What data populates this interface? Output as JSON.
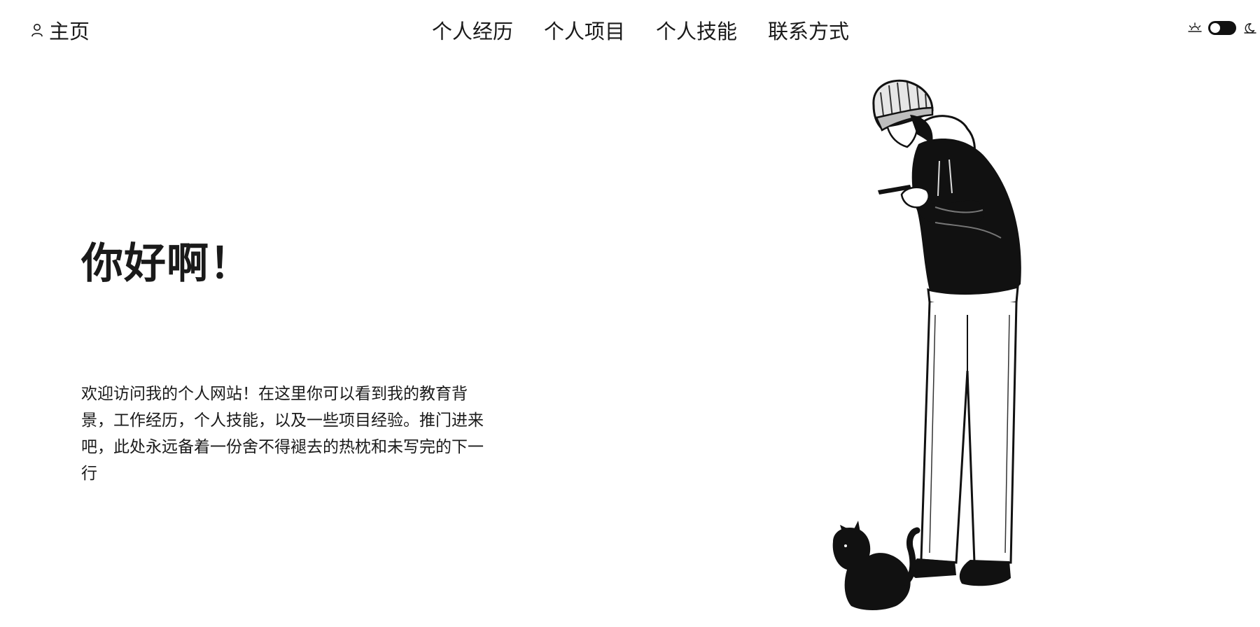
{
  "header": {
    "home": {
      "icon": "user-icon",
      "label": "主页"
    },
    "nav": [
      {
        "label": "个人经历"
      },
      {
        "label": "个人项目"
      },
      {
        "label": "个人技能"
      },
      {
        "label": "联系方式"
      }
    ],
    "theme": {
      "left_icon": "sunrise-icon",
      "right_icon": "moon-icon",
      "toggle_state": "dark"
    }
  },
  "hero": {
    "title": "你好啊！",
    "description": "欢迎访问我的个人网站！在这里你可以看到我的教育背景，工作经历，个人技能，以及一些项目经验。推门进来吧，此处永远备着一份舍不得褪去的热枕和未写完的下一行",
    "illustration": "person-with-phone-and-cat-illustration"
  },
  "colors": {
    "background": "#ffffff",
    "text": "#1a1a1a",
    "toggle": "#111111"
  }
}
